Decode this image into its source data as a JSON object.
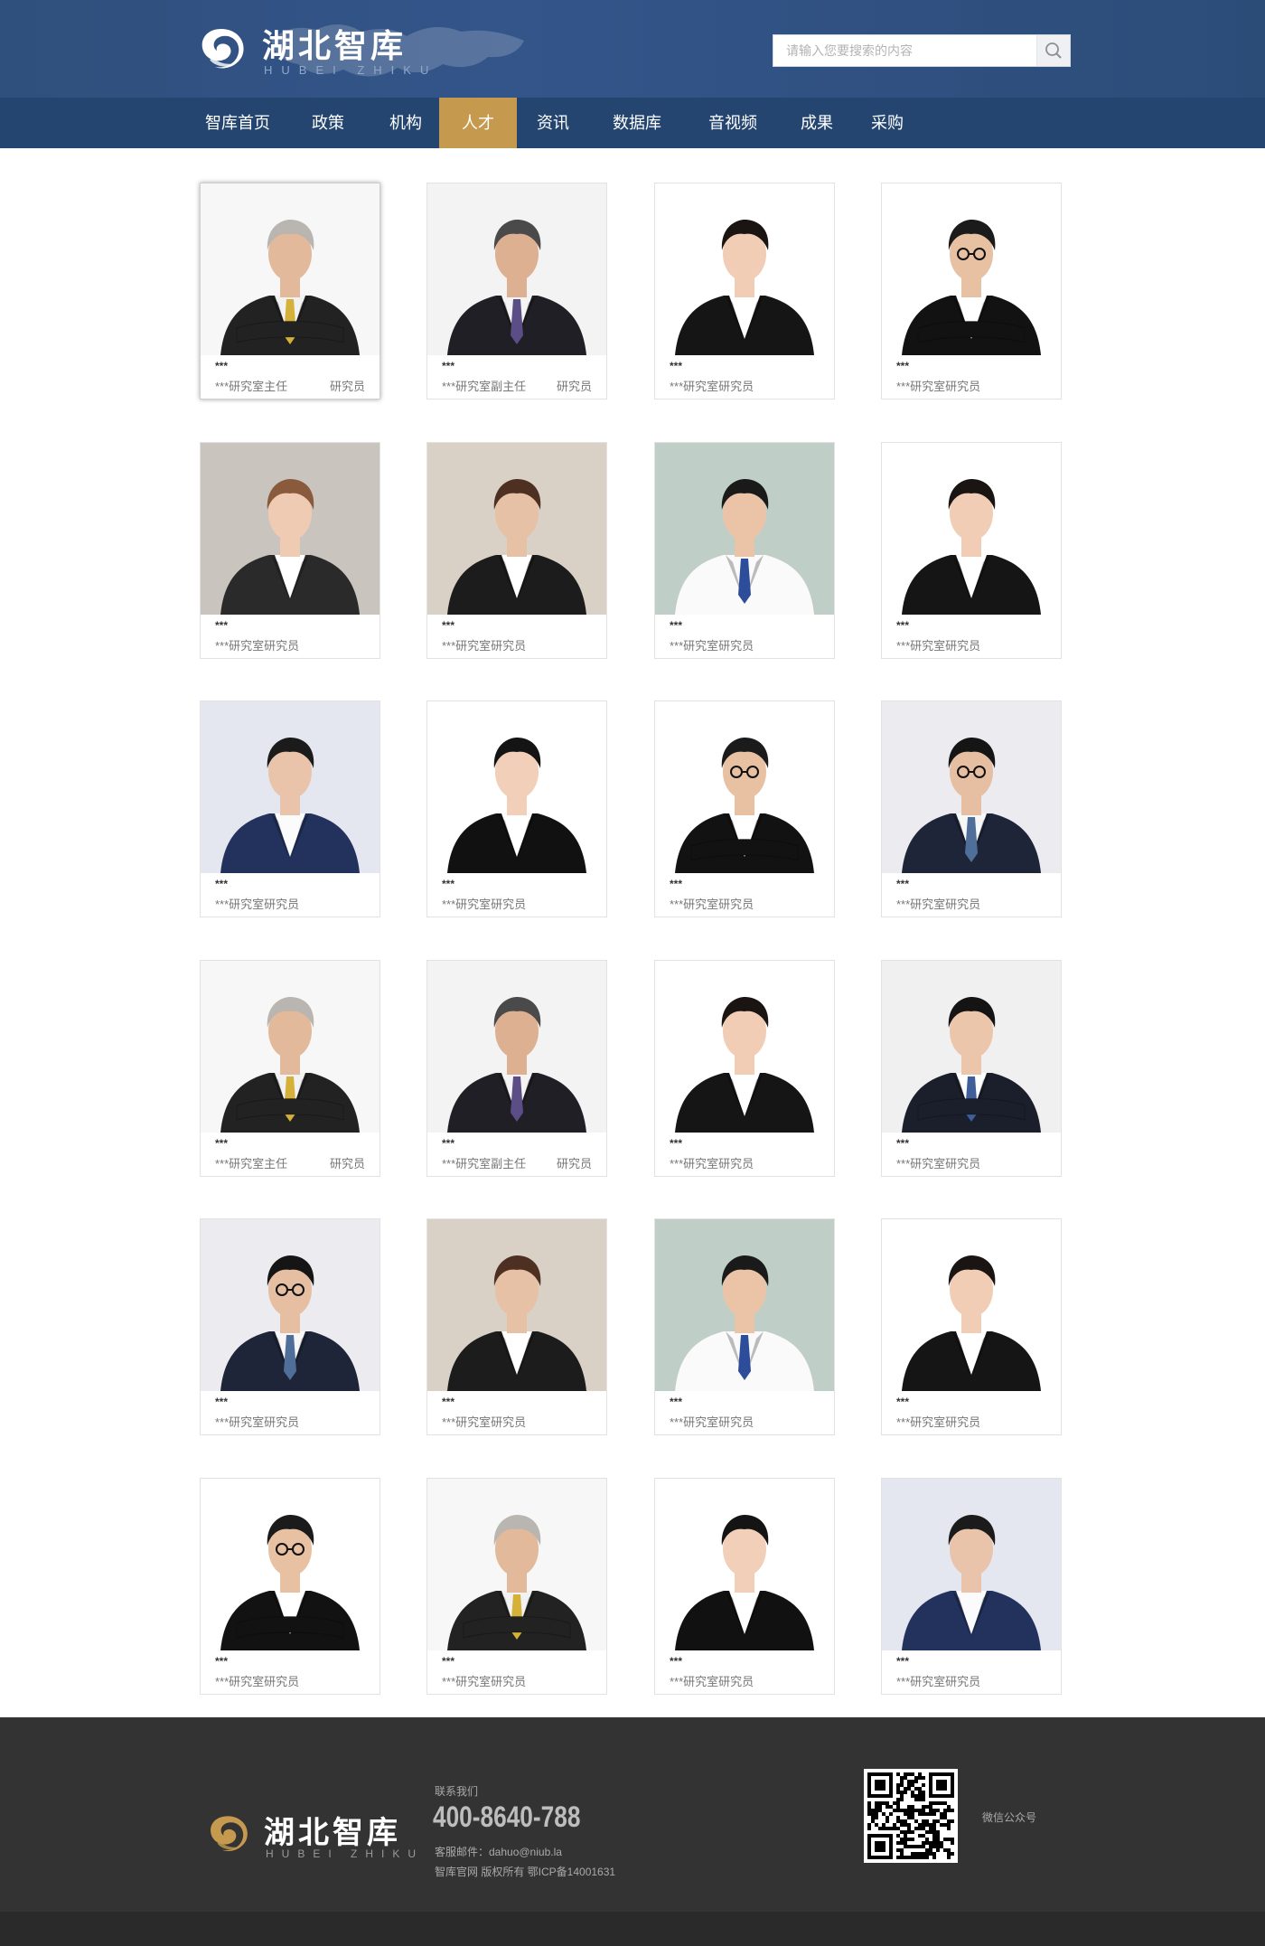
{
  "header": {
    "logo_cn": "湖北智库",
    "logo_en": "HUBEI ZHIKU",
    "search_placeholder": "请输入您要搜索的内容"
  },
  "nav": [
    {
      "label": "智库首页",
      "active": false
    },
    {
      "label": "政策",
      "active": false
    },
    {
      "label": "机构",
      "active": false
    },
    {
      "label": "人才",
      "active": true
    },
    {
      "label": "资讯",
      "active": false
    },
    {
      "label": "数据库",
      "active": false
    },
    {
      "label": "音视频",
      "active": false
    },
    {
      "label": "成果",
      "active": false
    },
    {
      "label": "采购",
      "active": false
    }
  ],
  "experts": [
    {
      "photo": "older-man-yellow-tie",
      "name": "***",
      "title": "***研究室主任",
      "role": "研究员"
    },
    {
      "photo": "older-man-purple-tie",
      "name": "***",
      "title": "***研究室副主任",
      "role": "研究员"
    },
    {
      "photo": "woman-short-hair-black-suit",
      "name": "***",
      "title": "***研究室研究员",
      "role": ""
    },
    {
      "photo": "man-glasses-arms-crossed",
      "name": "***",
      "title": "***研究室研究员",
      "role": ""
    },
    {
      "photo": "woman-ponytail-office",
      "name": "***",
      "title": "***研究室研究员",
      "role": ""
    },
    {
      "photo": "woman-long-brown-hair",
      "name": "***",
      "title": "***研究室研究员",
      "role": ""
    },
    {
      "photo": "young-man-white-shirt-blue-tie",
      "name": "***",
      "title": "***研究室研究员",
      "role": ""
    },
    {
      "photo": "woman-short-hair-black-suit",
      "name": "***",
      "title": "***研究室研究员",
      "role": ""
    },
    {
      "photo": "young-man-navy-blazer",
      "name": "***",
      "title": "***研究室研究员",
      "role": ""
    },
    {
      "photo": "woman-black-suit",
      "name": "***",
      "title": "***研究室研究员",
      "role": ""
    },
    {
      "photo": "man-glasses-arms-crossed",
      "name": "***",
      "title": "***研究室研究员",
      "role": ""
    },
    {
      "photo": "man-round-glasses-navy-suit",
      "name": "***",
      "title": "***研究室研究员",
      "role": ""
    },
    {
      "photo": "older-man-yellow-tie",
      "name": "***",
      "title": "***研究室主任",
      "role": "研究员"
    },
    {
      "photo": "older-man-purple-tie",
      "name": "***",
      "title": "***研究室副主任",
      "role": "研究员"
    },
    {
      "photo": "woman-short-hair-black-suit",
      "name": "***",
      "title": "***研究室研究员",
      "role": ""
    },
    {
      "photo": "young-man-suit-with-cup",
      "name": "***",
      "title": "***研究室研究员",
      "role": ""
    },
    {
      "photo": "man-round-glasses-navy-suit",
      "name": "***",
      "title": "***研究室研究员",
      "role": ""
    },
    {
      "photo": "woman-long-brown-hair",
      "name": "***",
      "title": "***研究室研究员",
      "role": ""
    },
    {
      "photo": "young-man-white-shirt-blue-tie",
      "name": "***",
      "title": "***研究室研究员",
      "role": ""
    },
    {
      "photo": "woman-short-hair-black-suit",
      "name": "***",
      "title": "***研究室研究员",
      "role": ""
    },
    {
      "photo": "man-glasses-arms-crossed",
      "name": "***",
      "title": "***研究室研究员",
      "role": ""
    },
    {
      "photo": "older-man-yellow-tie",
      "name": "***",
      "title": "***研究室研究员",
      "role": ""
    },
    {
      "photo": "woman-black-suit",
      "name": "***",
      "title": "***研究室研究员",
      "role": ""
    },
    {
      "photo": "young-man-navy-blazer",
      "name": "***",
      "title": "***研究室研究员",
      "role": ""
    }
  ],
  "footer": {
    "logo_cn": "湖北智库",
    "logo_en": "HUBEI ZHIKU",
    "contact_label": "联系我们",
    "phone": "400-8640-788",
    "email": "客服邮件：dahuo@niub.la",
    "icp": "智库官网  版权所有  鄂ICP备14001631",
    "qr_label": "微信公众号"
  },
  "colors": {
    "header_bg": "#2f4f7c",
    "nav_bg": "#24456f",
    "nav_active": "#c59a4e",
    "footer_bg": "#333333",
    "footer_logo_accent": "#c59a4e"
  }
}
